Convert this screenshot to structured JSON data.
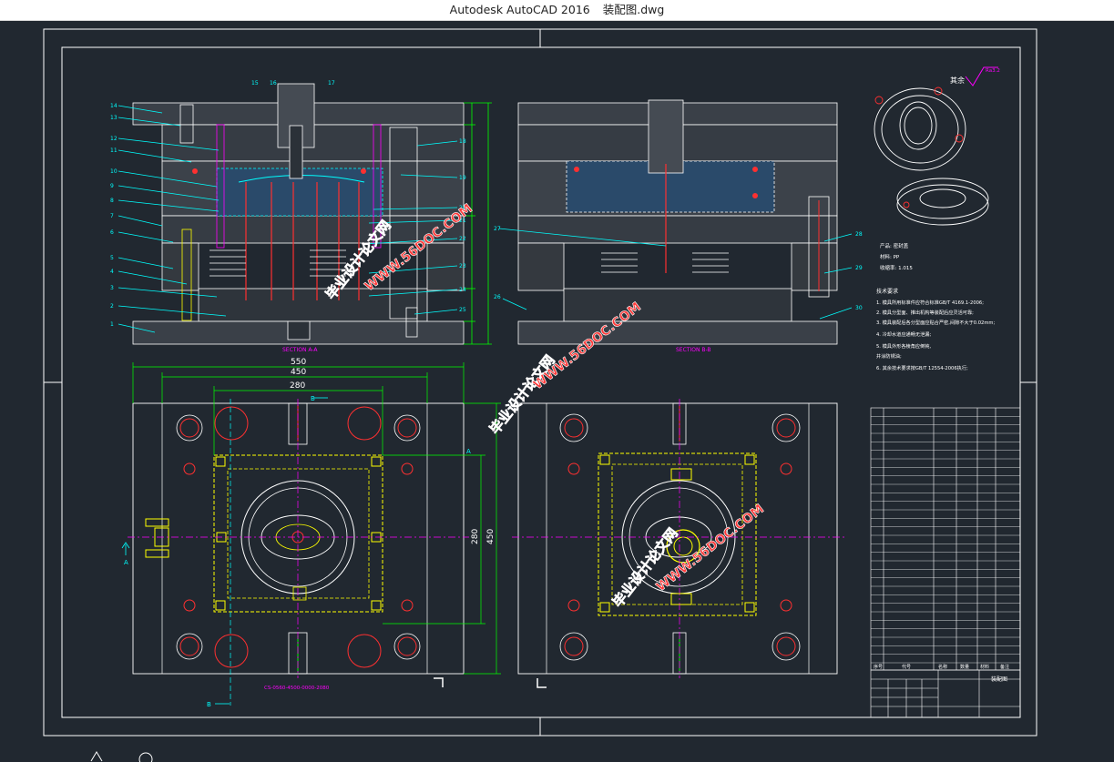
{
  "window": {
    "app": "Autodesk AutoCAD 2016",
    "file": "装配图.dwg"
  },
  "colors": {
    "bg": "#212830",
    "frame": "#ffffff",
    "cyan": "#00ffff",
    "yellow": "#ffff00",
    "red": "#ff3030",
    "magenta": "#ff00ff",
    "green": "#00ff00",
    "watermark": "#ff3b3b"
  },
  "dims": {
    "d550": "550",
    "d450": "450",
    "d280": "280",
    "d280v": "280",
    "d450v": "450"
  },
  "section_labels": {
    "aa": "SECTION A-A",
    "bb": "SECTION B-B"
  },
  "part_numbers_left": [
    "14",
    "13",
    "12",
    "11",
    "10",
    "9",
    "8",
    "7",
    "6",
    "5",
    "4",
    "3",
    "2",
    "1"
  ],
  "part_numbers_top": [
    "15",
    "16",
    "17"
  ],
  "part_numbers_right": [
    "18",
    "19",
    "20",
    "21",
    "22",
    "23",
    "24",
    "25"
  ],
  "part_numbers_bb": [
    "26",
    "27",
    "28",
    "29",
    "30"
  ],
  "roughness": "其余",
  "roughness_value": "Ra3.2",
  "product_info": [
    "产品: 密封盖",
    "材料: PP",
    "收缩率: 1.015"
  ],
  "tech_title": "技术要求",
  "tech_reqs": [
    "1. 模具所用标准件应符合标准GB/T 4169.1-2006;",
    "2. 模具分型面、推出机构等装配后应灵活可靠;",
    "3. 模具装配后各分型面应贴合严密,间隙不大于0.02mm;",
    "4. 冷却水道应通畅无泄漏;",
    "5. 模具外形各棱角应倒钝,",
    "   并涂防锈油;",
    "6. 其余技术要求按GB/T 12554-2006执行;"
  ],
  "watermarks": [
    "毕业设计论文网",
    "WWW.56DOC.COM"
  ],
  "mold_code": "CS-0560-4500-0000-2080",
  "cross_labels": {
    "a1": "A",
    "a2": "A",
    "b1": "B",
    "b2": "B"
  },
  "bom_header": [
    "序号",
    "代号",
    "名称",
    "数量",
    "材料",
    "备注"
  ],
  "title_block": {
    "drawing_title": "装配图"
  }
}
